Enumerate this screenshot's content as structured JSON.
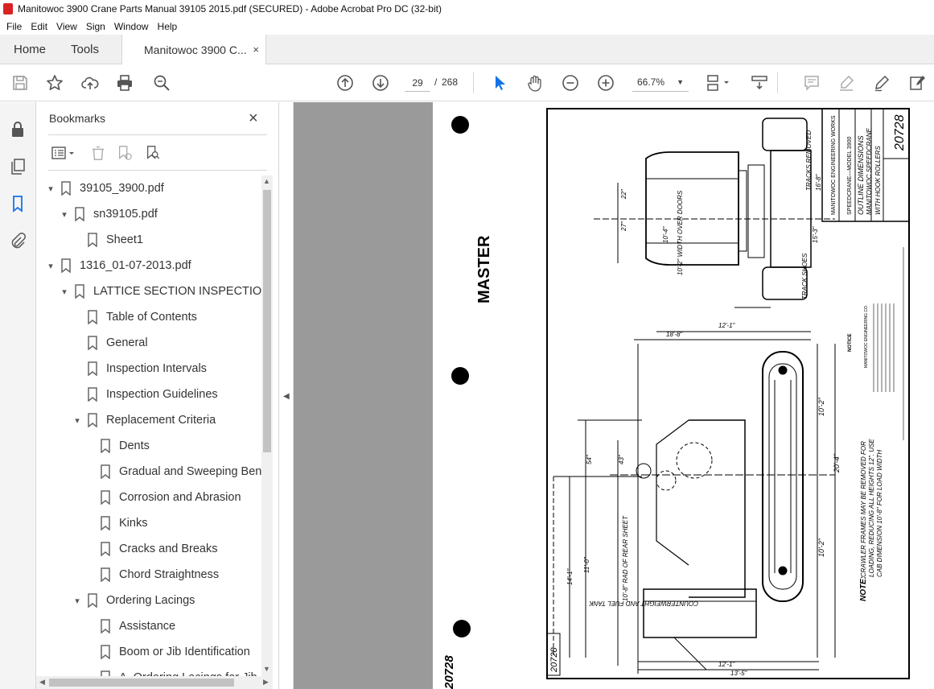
{
  "window": {
    "title": "Manitowoc 3900 Crane Parts Manual 39105 2015.pdf (SECURED) - Adobe Acrobat Pro DC (32-bit)"
  },
  "menu": [
    "File",
    "Edit",
    "View",
    "Sign",
    "Window",
    "Help"
  ],
  "tabs": {
    "home": "Home",
    "tools": "Tools",
    "document": "Manitowoc 3900 C...",
    "close": "×"
  },
  "toolbar": {
    "current_page": "29",
    "separator": "/",
    "total_pages": "268",
    "zoom": "66.7%"
  },
  "bookmarks": {
    "title": "Bookmarks",
    "close": "×",
    "items": [
      {
        "label": "39105_3900.pdf",
        "level": 0,
        "expander": "▾"
      },
      {
        "label": "sn39105.pdf",
        "level": 1,
        "expander": "▾"
      },
      {
        "label": "Sheet1",
        "level": 2,
        "expander": ""
      },
      {
        "label": "1316_01-07-2013.pdf",
        "level": 0,
        "expander": "▾"
      },
      {
        "label": "LATTICE SECTION INSPECTION",
        "level": 1,
        "expander": "▾"
      },
      {
        "label": "Table of Contents",
        "level": 2,
        "expander": ""
      },
      {
        "label": "General",
        "level": 2,
        "expander": ""
      },
      {
        "label": "Inspection Intervals",
        "level": 2,
        "expander": ""
      },
      {
        "label": "Inspection Guidelines",
        "level": 2,
        "expander": ""
      },
      {
        "label": "Replacement Criteria",
        "level": 2,
        "expander": "▾"
      },
      {
        "label": "Dents",
        "level": 3,
        "expander": ""
      },
      {
        "label": "Gradual and Sweeping Bends",
        "level": 3,
        "expander": ""
      },
      {
        "label": "Corrosion and Abrasion",
        "level": 3,
        "expander": ""
      },
      {
        "label": "Kinks",
        "level": 3,
        "expander": ""
      },
      {
        "label": "Cracks and Breaks",
        "level": 3,
        "expander": ""
      },
      {
        "label": "Chord Straightness",
        "level": 3,
        "expander": ""
      },
      {
        "label": "Ordering Lacings",
        "level": 2,
        "expander": "▾"
      },
      {
        "label": "Assistance",
        "level": 3,
        "expander": ""
      },
      {
        "label": "Boom or Jib Identification",
        "level": 3,
        "expander": ""
      },
      {
        "label": "A. Ordering Lacings for Jib",
        "level": 3,
        "expander": ""
      }
    ]
  },
  "drawing": {
    "stamp": "MASTER",
    "drawing_number": "20728",
    "company": "MANITOWOC ENGINEERING WORKS",
    "model_line": "SPEEDCRANE—MODEL 3900",
    "title_line_1": "OUTLINE DIMENSIONS",
    "title_line_2": "MANITOWOC SPEEDCRANE",
    "title_line_3": "WITH HOOK ROLLERS",
    "note_label": "NOTE:",
    "note_text_1": "CRAWLER FRAMES MAY BE REMOVED FOR",
    "note_text_2": "LOADING, REDUCING ALL HEIGHTS 12\". USE",
    "note_text_3": "CAB DIMENSION 10'-8\" FOR LOAD WIDTH",
    "counterweight": "COUNTERWEIGHT AND FUEL TANK",
    "radius": "10'-8\" RAD OF REAR SHEET",
    "width_doors": "10'-2\" WIDTH OVER DOORS",
    "dims": {
      "d1": "10'-4\"",
      "d2": "20'-4\"",
      "d3": "10'-2\"",
      "d4": "10'-2\"",
      "d5": "11'-0\"",
      "d6": "14'-1\"",
      "d7": "12'-1\"",
      "d8": "13'-5\"",
      "d9": "18'-8\"",
      "d10": "16'-8\"",
      "d11": "15'-3\"",
      "d12": "54\"",
      "d13": "43\"",
      "d14": "22\"",
      "d15": "27\"",
      "d16": "12'-1\""
    },
    "tracks_removed": "TRACKS REMOVED",
    "track_shoes": "TRACK SHOES",
    "notice": "NOTICE",
    "notice_company": "MANITOWOC ENGINEERING CO."
  }
}
